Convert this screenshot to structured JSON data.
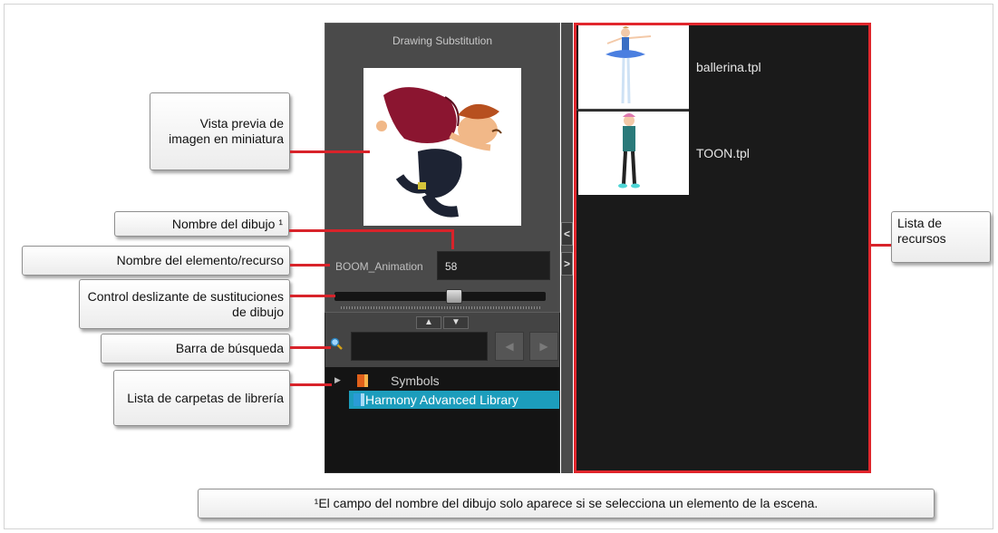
{
  "panel": {
    "title": "Drawing Substitution",
    "element_name": "BOOM_Animation",
    "drawing_name": "58",
    "slider_position": 0.57,
    "tree": [
      {
        "label": "Symbols",
        "selected": false
      },
      {
        "label": "Harmony Advanced Library",
        "selected": true
      }
    ]
  },
  "assets": [
    {
      "name": "ballerina.tpl"
    },
    {
      "name": "TOON.tpl"
    }
  ],
  "callouts": {
    "thumbnail": "Vista previa de imagen en miniatura",
    "drawing_name": "Nombre del dibujo ¹",
    "element_name": "Nombre del elemento/recurso",
    "slider": "Control deslizante de sustituciones de dibujo",
    "search": "Barra de búsqueda",
    "folders": "Lista de carpetas de librería",
    "asset_list": "Lista de recursos",
    "footnote": "¹El campo del nombre del dibujo solo aparece si se selecciona un elemento de la escena."
  },
  "colors": {
    "highlight": "#e1262c",
    "selection": "#1c9dbc"
  },
  "icons": [
    "search-icon",
    "folder-icon",
    "chevron-up-icon",
    "chevron-down-icon",
    "chevron-left-icon",
    "chevron-right-icon",
    "caret-right-icon"
  ]
}
